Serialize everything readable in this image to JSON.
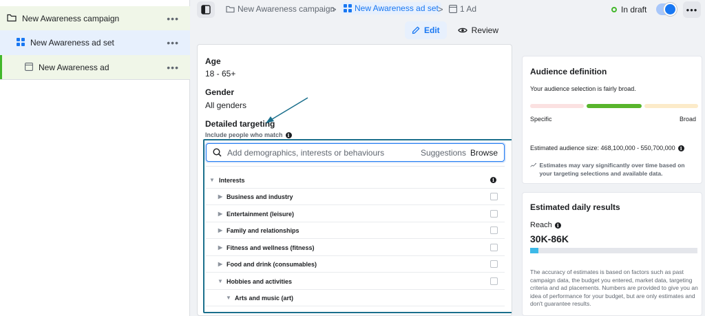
{
  "sidebar": {
    "items": [
      {
        "label": "New Awareness campaign",
        "icon": "folder-icon",
        "more": "•••"
      },
      {
        "label": "New Awareness ad set",
        "icon": "grid-icon",
        "more": "•••"
      },
      {
        "label": "New Awareness ad",
        "icon": "ad-icon",
        "more": "•••"
      }
    ]
  },
  "header": {
    "breadcrumbs": [
      {
        "label": "New Awareness campaign",
        "icon": "folder-icon"
      },
      {
        "label": "New Awareness ad set",
        "icon": "grid-icon"
      },
      {
        "label": "1 Ad",
        "icon": "ad-icon"
      }
    ],
    "separator": ">",
    "status": "In draft",
    "more": "•••",
    "tabs": [
      {
        "label": "Edit",
        "icon": "pencil-icon",
        "active": true
      },
      {
        "label": "Review",
        "icon": "eye-icon",
        "active": false
      }
    ]
  },
  "form": {
    "age_label": "Age",
    "age_value": "18 - 65+",
    "gender_label": "Gender",
    "gender_value": "All genders",
    "targeting_label": "Detailed targeting",
    "targeting_helper": "Include people who match",
    "search": {
      "placeholder": "Add demographics, interests or behaviours",
      "suggestions": "Suggestions",
      "browse": "Browse"
    },
    "list": [
      {
        "label": "Interests",
        "level": 0,
        "expanded": true,
        "checkbox": false,
        "info": true
      },
      {
        "label": "Business and industry",
        "level": 1,
        "expanded": false,
        "checkbox": true
      },
      {
        "label": "Entertainment (leisure)",
        "level": 1,
        "expanded": false,
        "checkbox": true
      },
      {
        "label": "Family and relationships",
        "level": 1,
        "expanded": false,
        "checkbox": true
      },
      {
        "label": "Fitness and wellness (fitness)",
        "level": 1,
        "expanded": false,
        "checkbox": true
      },
      {
        "label": "Food and drink (consumables)",
        "level": 1,
        "expanded": false,
        "checkbox": true
      },
      {
        "label": "Hobbies and activities",
        "level": 1,
        "expanded": true,
        "checkbox": true
      },
      {
        "label": "Arts and music (art)",
        "level": 2,
        "expanded": true,
        "checkbox": false
      }
    ]
  },
  "audience": {
    "title": "Audience definition",
    "subtitle": "Your audience selection is fairly broad.",
    "specific": "Specific",
    "broad": "Broad",
    "size": "Estimated audience size: 468,100,000 - 550,700,000",
    "note": "Estimates may vary significantly over time based on your targeting selections and available data."
  },
  "results": {
    "title": "Estimated daily results",
    "reach_label": "Reach",
    "reach_value": "30K-86K",
    "reach_fill_fraction": 0.05,
    "description": "The accuracy of estimates is based on factors such as past campaign data, the budget you entered, market data, targeting criteria and ad placements. Numbers are provided to give you an idea of performance for your budget, but are only estimates and don't guarantee results."
  },
  "colors": {
    "accent": "#1877f2",
    "highlight_outline": "#1a6f8c",
    "status_green": "#42b72a",
    "reach_bar": "#3db9e8"
  }
}
